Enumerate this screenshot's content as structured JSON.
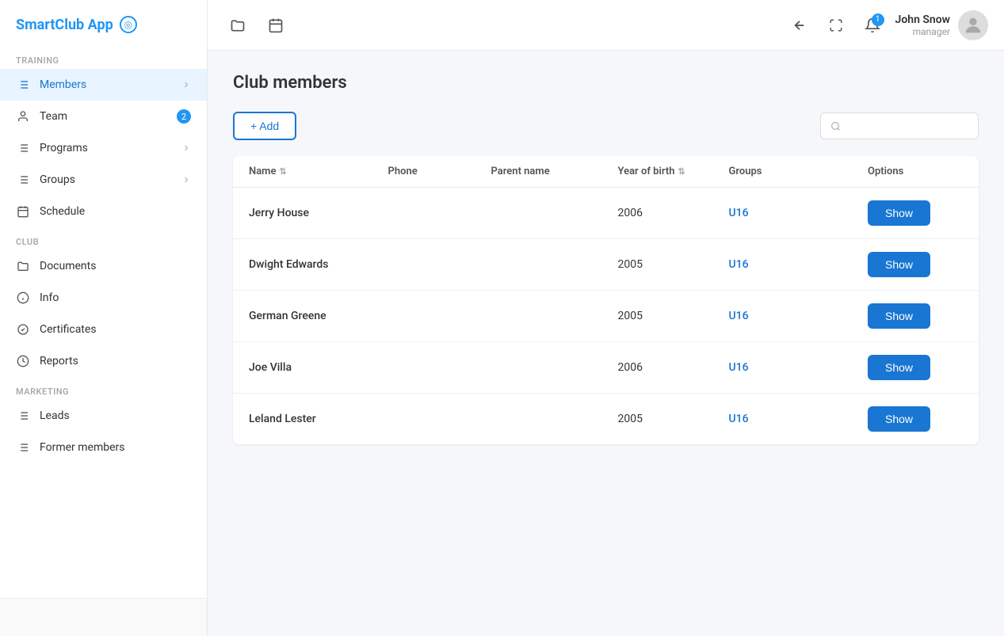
{
  "app": {
    "name": "SmartClub App",
    "logo_icon": "◎"
  },
  "sidebar": {
    "sections": [
      {
        "label": "TRAINING",
        "items": [
          {
            "id": "members",
            "label": "Members",
            "icon": "list",
            "hasChevron": true,
            "active": true
          },
          {
            "id": "team",
            "label": "Team",
            "icon": "person",
            "hasChevron": false,
            "badge": "2"
          },
          {
            "id": "programs",
            "label": "Programs",
            "icon": "list",
            "hasChevron": true
          },
          {
            "id": "groups",
            "label": "Groups",
            "icon": "list",
            "hasChevron": true
          },
          {
            "id": "schedule",
            "label": "Schedule",
            "icon": "calendar",
            "hasChevron": false
          }
        ]
      },
      {
        "label": "CLUB",
        "items": [
          {
            "id": "documents",
            "label": "Documents",
            "icon": "folder",
            "hasChevron": false
          },
          {
            "id": "info",
            "label": "Info",
            "icon": "info",
            "hasChevron": false
          },
          {
            "id": "certificates",
            "label": "Certificates",
            "icon": "badge",
            "hasChevron": false
          },
          {
            "id": "reports",
            "label": "Reports",
            "icon": "clock",
            "hasChevron": false
          }
        ]
      },
      {
        "label": "MARKETING",
        "items": [
          {
            "id": "leads",
            "label": "Leads",
            "icon": "list",
            "hasChevron": false
          },
          {
            "id": "former-members",
            "label": "Former members",
            "icon": "list",
            "hasChevron": false
          }
        ]
      }
    ]
  },
  "topbar": {
    "folder_icon": "folder",
    "calendar_icon": "calendar",
    "back_icon": "←",
    "fullscreen_icon": "⛶",
    "notification_count": "1",
    "user": {
      "name": "John Snow",
      "role": "manager"
    }
  },
  "page": {
    "title": "Club members",
    "add_button": "+ Add",
    "search_placeholder": ""
  },
  "table": {
    "columns": [
      {
        "label": "Name",
        "sortable": true
      },
      {
        "label": "Phone",
        "sortable": false
      },
      {
        "label": "Parent name",
        "sortable": false
      },
      {
        "label": "Year of birth",
        "sortable": true
      },
      {
        "label": "Groups",
        "sortable": false
      },
      {
        "label": "Options",
        "sortable": false
      }
    ],
    "rows": [
      {
        "id": 1,
        "name": "Jerry House",
        "phone": "",
        "parent_name": "",
        "year_of_birth": "2006",
        "group": "U16",
        "show_label": "Show"
      },
      {
        "id": 2,
        "name": "Dwight Edwards",
        "phone": "",
        "parent_name": "",
        "year_of_birth": "2005",
        "group": "U16",
        "show_label": "Show"
      },
      {
        "id": 3,
        "name": "German Greene",
        "phone": "",
        "parent_name": "",
        "year_of_birth": "2005",
        "group": "U16",
        "show_label": "Show"
      },
      {
        "id": 4,
        "name": "Joe Villa",
        "phone": "",
        "parent_name": "",
        "year_of_birth": "2006",
        "group": "U16",
        "show_label": "Show"
      },
      {
        "id": 5,
        "name": "Leland Lester",
        "phone": "",
        "parent_name": "",
        "year_of_birth": "2005",
        "group": "U16",
        "show_label": "Show"
      }
    ]
  }
}
